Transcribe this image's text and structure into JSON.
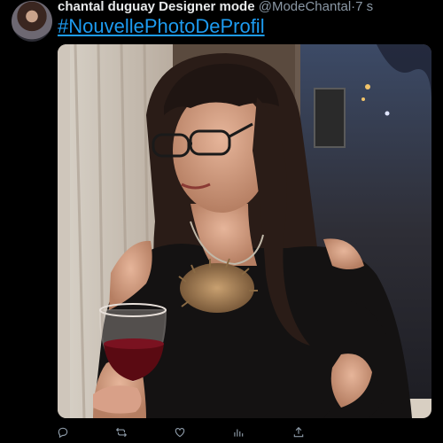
{
  "tweet": {
    "display_name": "chantal duguay Designer mode",
    "handle": "@ModeChantal",
    "separator": "·",
    "time": "7 s",
    "hashtag": "#NouvellePhotoDeProfil"
  },
  "avatar": {
    "icon": "profile-avatar"
  },
  "photo": {
    "subject": "woman with glasses holding a glass of red wine"
  },
  "actions": [
    {
      "name": "reply-icon"
    },
    {
      "name": "retweet-icon"
    },
    {
      "name": "like-icon"
    },
    {
      "name": "analytics-icon"
    },
    {
      "name": "share-icon"
    }
  ],
  "colors": {
    "background": "#000000",
    "text": "#e7e9ea",
    "muted": "#8b98a5",
    "link": "#1d9bf0"
  }
}
